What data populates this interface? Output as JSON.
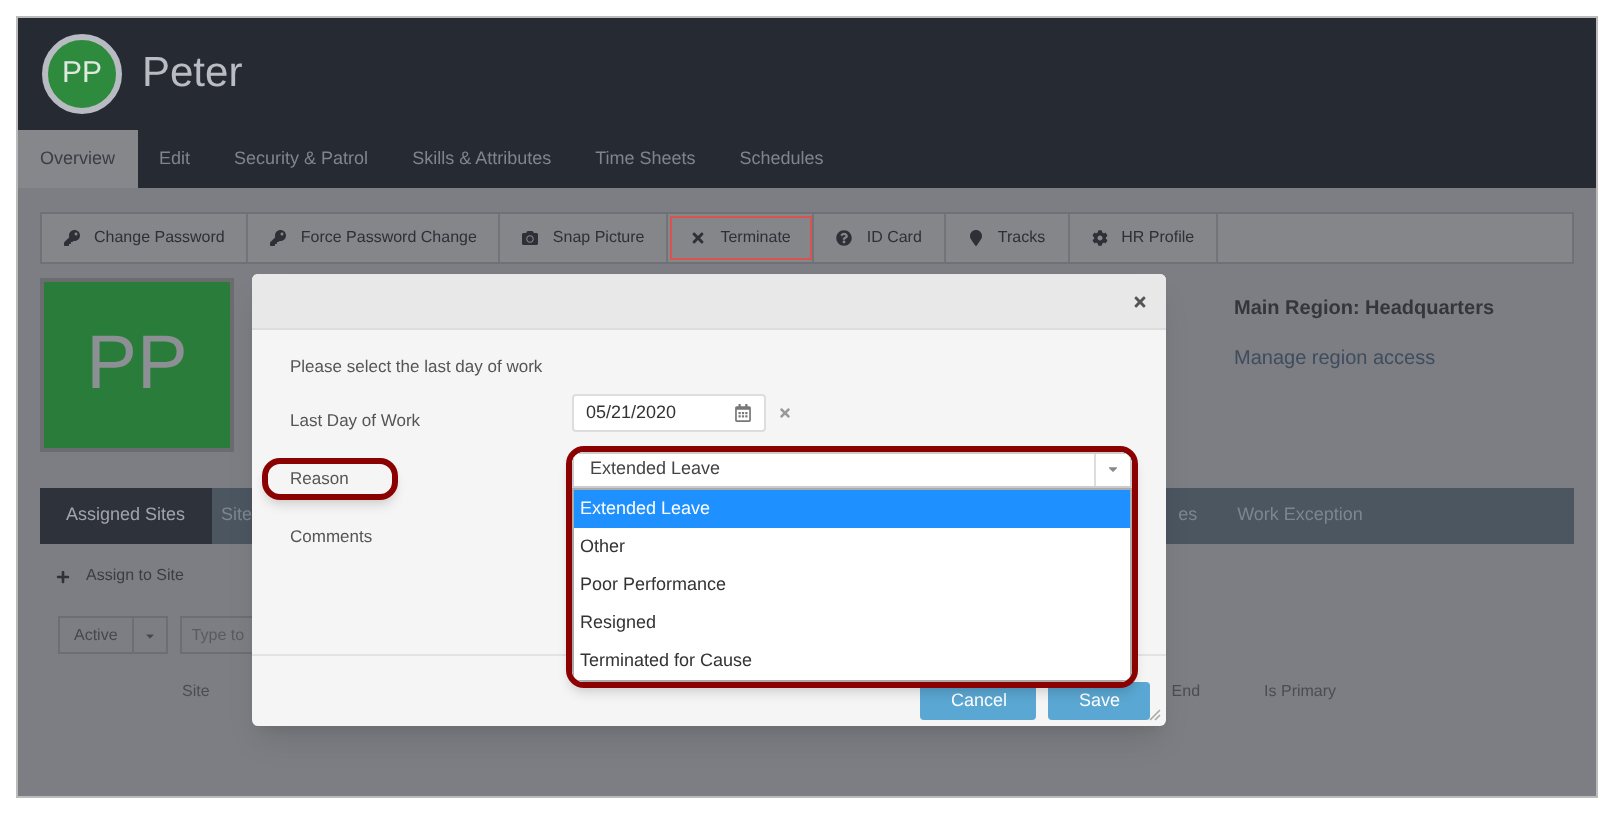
{
  "header": {
    "initials": "PP",
    "name": "Peter"
  },
  "tabs": [
    {
      "label": "Overview",
      "selected": true
    },
    {
      "label": "Edit",
      "selected": false
    },
    {
      "label": "Security & Patrol",
      "selected": false
    },
    {
      "label": "Skills & Attributes",
      "selected": false
    },
    {
      "label": "Time Sheets",
      "selected": false
    },
    {
      "label": "Schedules",
      "selected": false
    }
  ],
  "toolbar": [
    {
      "label": "Change Password",
      "kind": "key",
      "highlighted": false
    },
    {
      "label": "Force Password Change",
      "kind": "key",
      "highlighted": false
    },
    {
      "label": "Snap Picture",
      "kind": "camera",
      "highlighted": false
    },
    {
      "label": "Terminate",
      "kind": "cross",
      "highlighted": true
    },
    {
      "label": "ID Card",
      "kind": "help",
      "highlighted": false
    },
    {
      "label": "Tracks",
      "kind": "pin",
      "highlighted": false
    },
    {
      "label": "HR Profile",
      "kind": "gear",
      "highlighted": false
    }
  ],
  "profile": {
    "initials": "PP",
    "region": "Main Region: Headquarters",
    "region_link": "Manage region access"
  },
  "section_tabs": [
    {
      "label": "Assigned Sites",
      "selected": true
    },
    {
      "label": "Site",
      "selected": false
    },
    {
      "label": "es",
      "selected": false
    },
    {
      "label": "Work Exception",
      "selected": false
    }
  ],
  "assign_button": "Assign to Site",
  "filter": {
    "status": "Active",
    "search_placeholder": "Type to"
  },
  "table": {
    "columns": [
      "Site",
      "End",
      "Is Primary"
    ]
  },
  "dialog": {
    "prompt": "Please select the last day of work",
    "fields": [
      {
        "kind": "date",
        "label": "Last Day of Work",
        "value": "05/21/2020",
        "highlighted": false
      },
      {
        "kind": "select",
        "label": "Reason",
        "value": "Extended Leave",
        "highlighted": true,
        "expanded": true,
        "options": [
          {
            "label": "Extended Leave",
            "selected": true
          },
          {
            "label": "Other",
            "selected": false
          },
          {
            "label": "Poor Performance",
            "selected": false
          },
          {
            "label": "Resigned",
            "selected": false
          },
          {
            "label": "Terminated for Cause",
            "selected": false
          }
        ]
      },
      {
        "kind": "text",
        "label": "Comments",
        "highlighted": false
      }
    ],
    "buttons": [
      {
        "label": "Cancel"
      },
      {
        "label": "Save"
      }
    ]
  }
}
